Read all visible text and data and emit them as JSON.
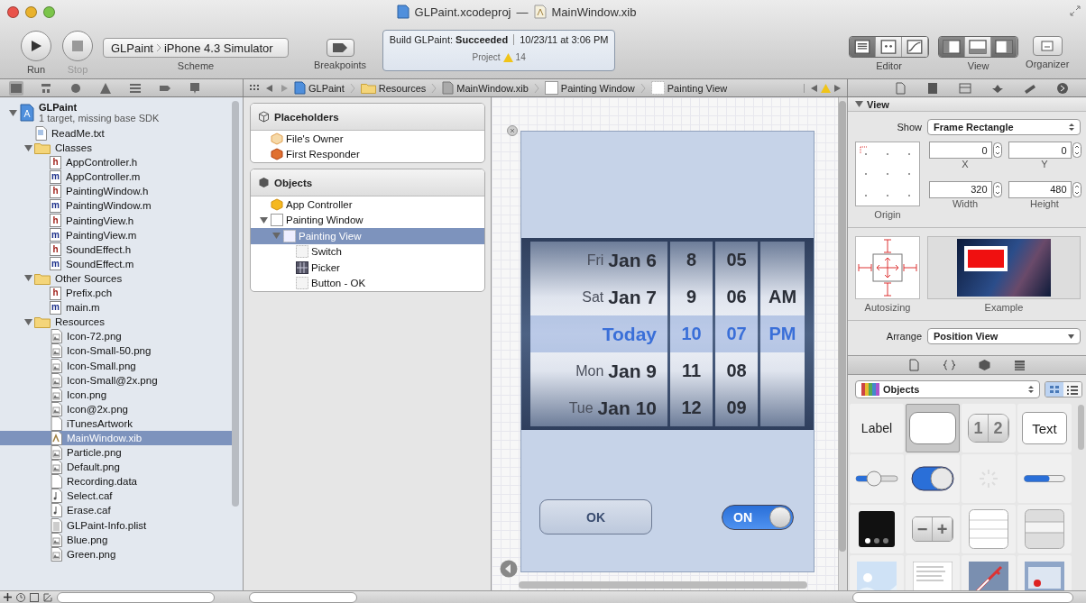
{
  "window": {
    "project": "GLPaint.xcodeproj",
    "separator": "—",
    "file": "MainWindow.xib"
  },
  "toolbar": {
    "run": {
      "label": "Run",
      "disabled": false
    },
    "stop": {
      "label": "Stop",
      "disabled": true
    },
    "scheme": {
      "project": "GLPaint",
      "destination": "iPhone 4.3 Simulator",
      "label": "Scheme"
    },
    "breakpoints": {
      "label": "Breakpoints",
      "on": false
    },
    "activity": {
      "status": "Build GLPaint: **Succeeded**",
      "time": "10/23/11 at 3:06 PM",
      "context": "Project",
      "warnings": "14"
    },
    "editor": {
      "label": "Editor",
      "modes": [
        {
          "kind": "standard",
          "selected": true
        },
        {
          "kind": "assistant",
          "selected": false
        },
        {
          "kind": "version",
          "selected": false
        }
      ]
    },
    "view": {
      "label": "View",
      "panes": [
        {
          "kind": "navigator",
          "on": true
        },
        {
          "kind": "debug",
          "on": false
        },
        {
          "kind": "utilities",
          "on": true
        }
      ]
    },
    "organizer": {
      "label": "Organizer"
    }
  },
  "navigator_tabs": [
    {
      "kind": "project",
      "selected": true
    },
    {
      "kind": "symbol",
      "selected": false
    },
    {
      "kind": "search",
      "selected": false
    },
    {
      "kind": "issue",
      "selected": false
    },
    {
      "kind": "debug",
      "selected": false
    },
    {
      "kind": "breakpoint",
      "selected": false
    },
    {
      "kind": "log",
      "selected": false
    }
  ],
  "jump_bar": {
    "crumbs": [
      {
        "kind": "project",
        "label": "GLPaint"
      },
      {
        "kind": "folder",
        "label": "Resources"
      },
      {
        "kind": "xib",
        "label": "MainWindow.xib"
      },
      {
        "kind": "window",
        "label": "Painting Window"
      },
      {
        "kind": "view",
        "label": "Painting View"
      }
    ]
  },
  "inspector_tabs": [
    {
      "kind": "file"
    },
    {
      "kind": "help"
    },
    {
      "kind": "identity"
    },
    {
      "kind": "attributes"
    },
    {
      "kind": "size"
    },
    {
      "kind": "connections"
    }
  ],
  "navigator": {
    "items": [
      {
        "kind": "project",
        "name": "GLPaint",
        "subtitle": "1 target, missing base SDK",
        "expanded": true,
        "selected": false,
        "children": [
          {
            "kind": "text",
            "name": "ReadMe.txt",
            "selected": false
          },
          {
            "kind": "folder",
            "name": "Classes",
            "expanded": true,
            "selected": false,
            "children": [
              {
                "kind": "header",
                "badge": "h",
                "name": "AppController.h",
                "selected": false
              },
              {
                "kind": "source",
                "badge": "m",
                "name": "AppController.m",
                "selected": false
              },
              {
                "kind": "header",
                "badge": "h",
                "name": "PaintingWindow.h",
                "selected": false
              },
              {
                "kind": "source",
                "badge": "m",
                "name": "PaintingWindow.m",
                "selected": false
              },
              {
                "kind": "header",
                "badge": "h",
                "name": "PaintingView.h",
                "selected": false
              },
              {
                "kind": "source",
                "badge": "m",
                "name": "PaintingView.m",
                "selected": false
              },
              {
                "kind": "header",
                "badge": "h",
                "name": "SoundEffect.h",
                "selected": false
              },
              {
                "kind": "source",
                "badge": "m",
                "name": "SoundEffect.m",
                "selected": false
              }
            ]
          },
          {
            "kind": "folder",
            "name": "Other Sources",
            "expanded": true,
            "selected": false,
            "children": [
              {
                "kind": "header",
                "badge": "h",
                "name": "Prefix.pch",
                "selected": false
              },
              {
                "kind": "source",
                "badge": "m",
                "name": "main.m",
                "selected": false
              }
            ]
          },
          {
            "kind": "folder",
            "name": "Resources",
            "expanded": true,
            "selected": false,
            "children": [
              {
                "kind": "image",
                "name": "Icon-72.png",
                "selected": false
              },
              {
                "kind": "image",
                "name": "Icon-Small-50.png",
                "selected": false
              },
              {
                "kind": "image",
                "name": "Icon-Small.png",
                "selected": false
              },
              {
                "kind": "image",
                "name": "Icon-Small@2x.png",
                "selected": false
              },
              {
                "kind": "image",
                "name": "Icon.png",
                "selected": false
              },
              {
                "kind": "image",
                "name": "Icon@2x.png",
                "selected": false
              },
              {
                "kind": "plain",
                "name": "iTunesArtwork",
                "selected": false
              },
              {
                "kind": "xib",
                "name": "MainWindow.xib",
                "selected": true
              },
              {
                "kind": "image",
                "name": "Particle.png",
                "selected": false
              },
              {
                "kind": "image",
                "name": "Default.png",
                "selected": false
              },
              {
                "kind": "plain",
                "name": "Recording.data",
                "selected": false
              },
              {
                "kind": "sound",
                "name": "Select.caf",
                "selected": false
              },
              {
                "kind": "sound",
                "name": "Erase.caf",
                "selected": false
              },
              {
                "kind": "plist",
                "name": "GLPaint-Info.plist",
                "selected": false
              },
              {
                "kind": "image",
                "name": "Blue.png",
                "selected": false
              },
              {
                "kind": "image",
                "name": "Green.png",
                "selected": false
              }
            ]
          }
        ]
      }
    ]
  },
  "outline": {
    "sections": [
      {
        "kind": "placeholders",
        "title": "Placeholders",
        "items": [
          {
            "kind": "owner",
            "name": "File's Owner",
            "selected": false
          },
          {
            "kind": "responder",
            "name": "First Responder",
            "selected": false
          }
        ]
      },
      {
        "kind": "objects",
        "title": "Objects",
        "items": [
          {
            "kind": "controller",
            "name": "App Controller",
            "selected": false
          },
          {
            "kind": "window",
            "name": "Painting Window",
            "expanded": true,
            "selected": false,
            "children": [
              {
                "kind": "view",
                "name": "Painting View",
                "expanded": true,
                "selected": true,
                "children": [
                  {
                    "kind": "control",
                    "name": "Switch",
                    "selected": false
                  },
                  {
                    "kind": "picker",
                    "name": "Picker",
                    "selected": false
                  },
                  {
                    "kind": "control",
                    "name": "Button - OK",
                    "selected": false
                  }
                ]
              }
            ]
          }
        ]
      }
    ]
  },
  "canvas": {
    "picker": {
      "rows": [
        {
          "date": "Fri **Jan 6**",
          "hour": "8",
          "minute": "05",
          "selected": false
        },
        {
          "date": "Sat **Jan 7**",
          "hour": "9",
          "minute": "06",
          "period": "AM",
          "selected": false
        },
        {
          "date": "Today",
          "hour": "10",
          "minute": "07",
          "period": "PM",
          "selected": true
        },
        {
          "date": "Mon **Jan 9**",
          "hour": "11",
          "minute": "08",
          "selected": false
        },
        {
          "date": "Tue **Jan 10**",
          "hour": "12",
          "minute": "09",
          "selected": false
        }
      ]
    },
    "button": "OK",
    "switch": {
      "label": "ON",
      "on": true
    }
  },
  "inspector": {
    "section": {
      "title": "View",
      "expanded": true
    },
    "show": {
      "label": "Show",
      "value": "Frame Rectangle"
    },
    "fields": [
      {
        "label": "X",
        "value": "0"
      },
      {
        "label": "Y",
        "value": "0"
      },
      {
        "label": "Width",
        "value": "320"
      },
      {
        "label": "Height",
        "value": "480"
      }
    ],
    "origin_label": "Origin",
    "autosizing_label": "Autosizing",
    "example_label": "Example",
    "arrange": {
      "label": "Arrange",
      "value": "Position View"
    }
  },
  "library_tabs": [
    {
      "kind": "file"
    },
    {
      "kind": "code"
    },
    {
      "kind": "objects"
    },
    {
      "kind": "media"
    }
  ],
  "library": {
    "filter": "Objects",
    "view_modes": [
      {
        "kind": "grid",
        "selected": true
      },
      {
        "kind": "list",
        "selected": false
      }
    ],
    "items": [
      {
        "kind": "label",
        "text": "Label",
        "selected": false
      },
      {
        "kind": "round_button",
        "selected": true
      },
      {
        "kind": "segmented",
        "segments": [
          "1",
          "2"
        ],
        "selected": false
      },
      {
        "kind": "text_field",
        "text": "Text",
        "selected": false
      },
      {
        "kind": "slider",
        "selected": false
      },
      {
        "kind": "switch",
        "selected": false
      },
      {
        "kind": "activity",
        "selected": false
      },
      {
        "kind": "progress",
        "selected": false
      },
      {
        "kind": "page_control",
        "selected": false
      },
      {
        "kind": "stepper",
        "symbols": [
          "−",
          "+"
        ],
        "selected": false
      },
      {
        "kind": "table",
        "selected": false
      },
      {
        "kind": "table_grouped",
        "selected": false
      },
      {
        "kind": "image",
        "selected": false
      },
      {
        "kind": "text_view",
        "selected": false
      },
      {
        "kind": "web_view",
        "selected": false
      },
      {
        "kind": "map_view",
        "selected": false
      }
    ]
  }
}
